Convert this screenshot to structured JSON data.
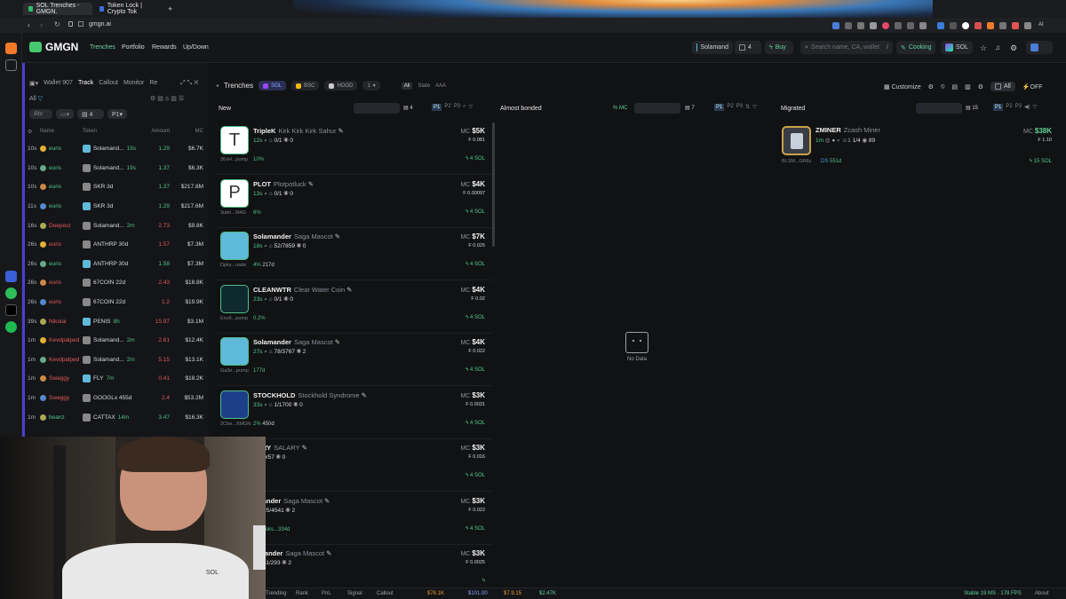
{
  "browser": {
    "tabs": [
      "SOL Trenches - GMGN.",
      "Token Lock | Crypto Tok"
    ],
    "url": "gmgn.ai"
  },
  "topnav": {
    "logo": "GMGN",
    "links": [
      "Trenches",
      "Portfolio",
      "Rewards",
      "Up/Down"
    ],
    "wallet": "Solamand",
    "count": "4",
    "buy": "Buy",
    "search_placeholder": "Search name, CA, wallet",
    "search_key": "/",
    "cooking": "Cooking",
    "chain": "SOL"
  },
  "left": {
    "wallet": "Wallet 907",
    "tabs": [
      "Track",
      "Callout",
      "Monitor",
      "Re"
    ],
    "filter_all": "All",
    "columns": [
      "Name",
      "Token",
      "Amount",
      "MC"
    ],
    "rows": [
      {
        "t": "10s",
        "name": "euris",
        "token": "Solamand...",
        "age": "19s",
        "amt": "1.29",
        "mc": "$6.7K",
        "buy": true
      },
      {
        "t": "10s",
        "name": "euris",
        "token": "Solamand...",
        "age": "19s",
        "amt": "1.37",
        "mc": "$6.3K",
        "buy": true
      },
      {
        "t": "10s",
        "name": "euris",
        "token": "SKR 3d",
        "age": "",
        "amt": "1.37",
        "mc": "$217.8M",
        "buy": true
      },
      {
        "t": "11s",
        "name": "euris",
        "token": "SKR 3d",
        "age": "",
        "amt": "1.29",
        "mc": "$217.6M",
        "buy": true
      },
      {
        "t": "16s",
        "name": "Deepest",
        "token": "Solamand...",
        "age": "2m",
        "amt": "2.73",
        "mc": "$9.8K",
        "buy": false
      },
      {
        "t": "26s",
        "name": "euris",
        "token": "ANTHRP 30d",
        "age": "",
        "amt": "1.57",
        "mc": "$7.3M",
        "buy": false
      },
      {
        "t": "26s",
        "name": "euris",
        "token": "ANTHRP 30d",
        "age": "",
        "amt": "1.58",
        "mc": "$7.3M",
        "buy": true
      },
      {
        "t": "26s",
        "name": "euris",
        "token": "67COIN 22d",
        "age": "",
        "amt": "2.43",
        "mc": "$18.8K",
        "buy": false
      },
      {
        "t": "26s",
        "name": "euris",
        "token": "67COIN 22d",
        "age": "",
        "amt": "1.2",
        "mc": "$19.9K",
        "buy": false
      },
      {
        "t": "39s",
        "name": "Nikolai",
        "token": "PENIS",
        "age": "8h",
        "amt": "15.97",
        "mc": "$3.1M",
        "buy": false
      },
      {
        "t": "1m",
        "name": "Kevdpalped",
        "token": "Solamand...",
        "age": "2m",
        "amt": "2.61",
        "mc": "$12.4K",
        "buy": false
      },
      {
        "t": "1m",
        "name": "Kevdpalped",
        "token": "Solamand...",
        "age": "2m",
        "amt": "5.15",
        "mc": "$13.1K",
        "buy": false
      },
      {
        "t": "1m",
        "name": "Swaggy",
        "token": "FLY",
        "age": "7m",
        "amt": "0.41",
        "mc": "$18.2K",
        "buy": false
      },
      {
        "t": "1m",
        "name": "Swaggy",
        "token": "GOOGLx 455d",
        "age": "",
        "amt": "2.4",
        "mc": "$53.2M",
        "buy": false
      },
      {
        "t": "1m",
        "name": "beanz",
        "token": "CATTAX",
        "age": "14m",
        "amt": "3.47",
        "mc": "$16.3K",
        "buy": true
      }
    ]
  },
  "trenches": {
    "title": "Trenches",
    "chains": [
      "SOL",
      "BSC",
      "HOOD"
    ],
    "num": "1",
    "filters": [
      "All",
      "Slate",
      "AAA"
    ],
    "customize": "Customize",
    "all": "All",
    "off": "OFF",
    "cols": {
      "new": "New",
      "almost": "Almost bonded",
      "migrated": "Migrated",
      "mc_label": "MC"
    },
    "presets": [
      "P1",
      "P2",
      "P3"
    ],
    "new_count": "4",
    "almost_count": "7",
    "mig_count": "15",
    "no_data": "No Data"
  },
  "cards": [
    {
      "sym": "TripleK",
      "full": "Kirk Kirk Kirk Sahur",
      "age": "12s",
      "stats": "0/1",
      "eyes": "0",
      "addr": "36xH...pump",
      "hold": "10%",
      "mc": "$5K",
      "f": "0.081",
      "sol": "4 SOL",
      "img": "T",
      "bg": "#ffffff",
      "fg": "#333"
    },
    {
      "sym": "PLOT",
      "full": "Plotpotluck",
      "age": "13s",
      "stats": "0/1",
      "eyes": "0",
      "addr": "3ubh...9t4G",
      "hold": "6%",
      "mc": "$4K",
      "f": "0.00097",
      "sol": "4 SOL",
      "img": "P",
      "bg": "#ffffff",
      "fg": "#333"
    },
    {
      "sym": "Solamander",
      "full": "Saga Mascot",
      "age": "18s",
      "stats": "52/7859",
      "eyes": "0",
      "addr": "Dpks...nade",
      "hold": "4%",
      "extra": "217d",
      "mc": "$7K",
      "f": "0.025",
      "sol": "4 SOL",
      "img": "",
      "bg": "#5fb9d8",
      "fg": "#fff"
    },
    {
      "sym": "CLEANWTR",
      "full": "Clear Water Coin",
      "age": "23s",
      "stats": "0/1",
      "eyes": "0",
      "addr": "Eno6...pump",
      "hold": "0.2%",
      "mc": "$4K",
      "f": "0.02",
      "sol": "4 SOL",
      "img": "",
      "bg": "#0f2a2e",
      "fg": "#6fe"
    },
    {
      "sym": "Solamander",
      "full": "Saga Mascot",
      "age": "27s",
      "stats": "78/3767",
      "eyes": "2",
      "addr": "Ga3e...pump",
      "hold": "177d",
      "mc": "$4K",
      "f": "0.022",
      "sol": "4 SOL",
      "img": "",
      "bg": "#5fb9d8",
      "fg": "#fff"
    },
    {
      "sym": "STOCKHOLD",
      "full": "Stockhold Syndrome",
      "age": "33s",
      "stats": "1/1700",
      "eyes": "0",
      "addr": "2C6e...XMGN",
      "hold": "2%",
      "extra": "450d",
      "mc": "$3K",
      "f": "0.0031",
      "sol": "4 SOL",
      "img": "",
      "bg": "#1d3f8a",
      "fg": "#fff"
    },
    {
      "sym": "LARY",
      "full": "SALARY",
      "age": "",
      "stats": "0/57",
      "eyes": "0",
      "addr": "",
      "hold": "413d",
      "mc": "$3K",
      "f": "0.016",
      "sol": "4 SOL",
      "img": "",
      "bg": "#222",
      "fg": "#fff"
    },
    {
      "sym": "amander",
      "full": "Saga Mascot",
      "age": "",
      "stats": "25/4541",
      "eyes": "2",
      "addr": "",
      "hold": "Schooks...334d",
      "mc": "$3K",
      "f": "0.022",
      "sol": "4 SOL",
      "img": "",
      "bg": "#222",
      "fg": "#fff"
    },
    {
      "sym": "lamander",
      "full": "Saga Mascot",
      "age": "",
      "stats": "11/293",
      "eyes": "2",
      "addr": "",
      "hold": "",
      "mc": "$3K",
      "f": "0.0025",
      "sol": "",
      "img": "",
      "bg": "#222",
      "fg": "#fff"
    }
  ],
  "migrated_card": {
    "sym": "ZMINER",
    "full": "Zcash Miner",
    "age": "1m",
    "stats": "1/4",
    "eyes": "89",
    "addr": "BLSM...GR6c",
    "hold": "551d",
    "mc": "$38K",
    "f": "1.10",
    "sol": "15 SOL",
    "holders": "DS"
  },
  "bottom": {
    "items": [
      "Trending",
      "Rank",
      "PnL",
      "Signal",
      "Callout"
    ],
    "p1": "$78.1K",
    "p2": "$101.00",
    "p3": "$7.9.15",
    "p4": "$2.47K",
    "status": "Stable 19 MS · 178 FPS",
    "about": "About"
  },
  "webcam": {
    "shirt": "SOL"
  }
}
